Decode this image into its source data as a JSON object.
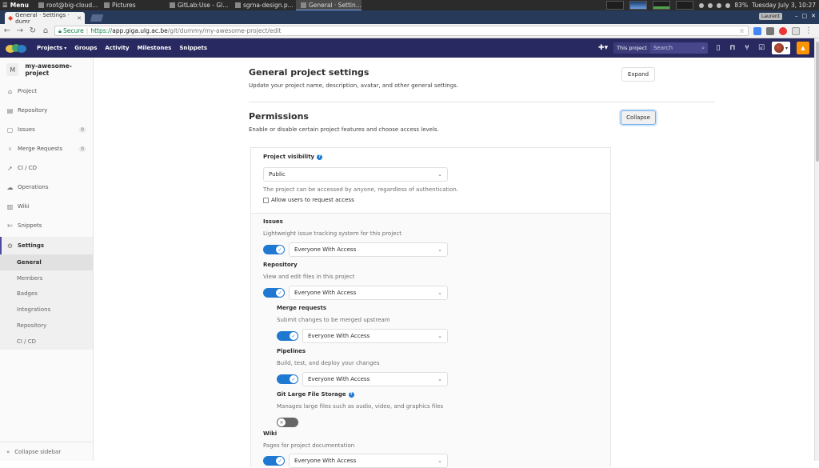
{
  "taskbar": {
    "menu_label": "Menu",
    "tasks": [
      {
        "label": "root@big-cloud...",
        "active": false
      },
      {
        "label": "Pictures",
        "active": false
      },
      {
        "label": "GitLab:Use - Gl...",
        "active": false
      },
      {
        "label": "sgrna-design.p...",
        "active": false
      },
      {
        "label": "General · Settin...",
        "active": true
      }
    ],
    "battery": "83%",
    "clock": "Tuesday July  3, 10:27"
  },
  "browser": {
    "tab_title": "General · Settings · dumr",
    "user_badge": "Laurent",
    "secure_label": "Secure",
    "url_proto": "https://",
    "url_host": "app.giga.ulg.ac.be",
    "url_path": "/git/dummy/my-awesome-project/edit"
  },
  "gitlab_header": {
    "nav": [
      "Projects",
      "Groups",
      "Activity",
      "Milestones",
      "Snippets"
    ],
    "this_project": "This project",
    "search_placeholder": "Search"
  },
  "sidebar": {
    "project_initial": "M",
    "project_name": "my-awesome-project",
    "items": [
      {
        "label": "Project",
        "icon": "home-icon",
        "count": ""
      },
      {
        "label": "Repository",
        "icon": "book-icon",
        "count": ""
      },
      {
        "label": "Issues",
        "icon": "issues-icon",
        "count": "0"
      },
      {
        "label": "Merge Requests",
        "icon": "merge-icon",
        "count": "0"
      },
      {
        "label": "CI / CD",
        "icon": "rocket-icon",
        "count": ""
      },
      {
        "label": "Operations",
        "icon": "cloud-icon",
        "count": ""
      },
      {
        "label": "Wiki",
        "icon": "book-icon",
        "count": ""
      },
      {
        "label": "Snippets",
        "icon": "snippet-icon",
        "count": ""
      }
    ],
    "settings_label": "Settings",
    "settings_sub": [
      "General",
      "Members",
      "Badges",
      "Integrations",
      "Repository",
      "CI / CD"
    ],
    "collapse_label": "Collapse sidebar"
  },
  "main": {
    "general": {
      "title": "General project settings",
      "desc": "Update your project name, description, avatar, and other general settings.",
      "button": "Expand"
    },
    "permissions": {
      "title": "Permissions",
      "desc": "Enable or disable certain project features and choose access levels.",
      "button": "Collapse",
      "visibility_label": "Project visibility",
      "visibility_value": "Public",
      "visibility_help": "The project can be accessed by anyone, regardless of authentication.",
      "request_access_label": "Allow users to request access",
      "features": [
        {
          "title": "Issues",
          "desc": "Lightweight issue tracking system for this project",
          "access": "Everyone With Access",
          "enabled": true
        },
        {
          "title": "Repository",
          "desc": "View and edit files in this project",
          "access": "Everyone With Access",
          "enabled": true
        },
        {
          "title": "Merge requests",
          "desc": "Submit changes to be merged upstream",
          "access": "Everyone With Access",
          "enabled": true
        },
        {
          "title": "Pipelines",
          "desc": "Build, test, and deploy your changes",
          "access": "Everyone With Access",
          "enabled": true
        },
        {
          "title": "Git Large File Storage",
          "desc": "Manages large files such as audio, video, and graphics files",
          "access": "",
          "enabled": false
        },
        {
          "title": "Wiki",
          "desc": "Pages for project documentation",
          "access": "Everyone With Access",
          "enabled": true
        }
      ]
    }
  }
}
